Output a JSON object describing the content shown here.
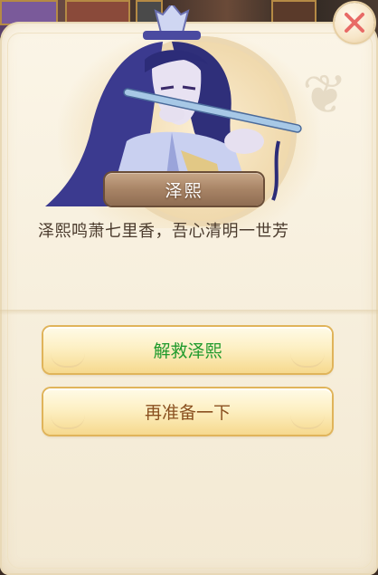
{
  "character": {
    "name": "泽熙",
    "quote": "泽熙鸣萧七里香，吾心清明一世芳"
  },
  "buttons": {
    "rescue_label": "解救泽熙",
    "prepare_label": "再准备一下"
  },
  "icons": {
    "close": "close-icon"
  },
  "colors": {
    "rescue_text": "#1f9a2c",
    "prepare_text": "#8a5020",
    "close_x": "#e86a66"
  }
}
